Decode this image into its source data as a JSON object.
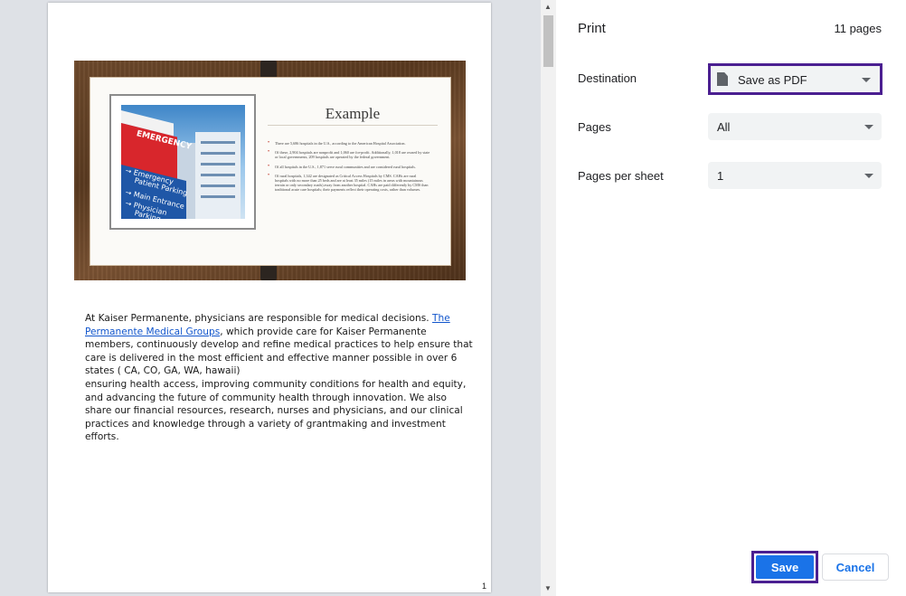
{
  "preview": {
    "slide": {
      "title": "Example",
      "photo_sign_text": [
        "EMERGENCY",
        "→ Emergency",
        "Patient Parking",
        "→ Main Entrance",
        "→ Physician",
        "Parking"
      ],
      "bullets": [
        "There are 5,686 hospitals in the U.S., according to the American Hospital Association.",
        "Of these, 2,904 hospitals are nonprofit and 1,060 are for-profit. Additionally, 1,018 are owned by state or local governments, 209 hospitals are operated by the federal government.",
        "Of all hospitals in the U.S., 1,871 serve rural communities and are considered rural hospitals.",
        "Of rural hospitals, 1,342 are designated as Critical Access Hospitals by CMS. CAHs are rural hospitals with no more than 25 beds and are at least 35 miles (15 miles in areas with mountainous terrain or only secondary roads) away from another hospital. CAHs are paid differently by CMS than traditional acute care hospitals; their payments reflect their operating costs, rather than volumes."
      ]
    },
    "paragraph": {
      "part1": "At Kaiser Permanente, physicians are responsible for medical decisions.",
      "link": "The Permanente Medical Groups",
      "part2": ", which provide care for Kaiser Permanente members, continuously develop and refine medical practices to help ensure that care is delivered in the most efficient and effective manner possible in over 6 states ( CA, CO, GA, WA, hawaii)",
      "part3": "ensuring health access, improving community  conditions for health and equity, and advancing the future of community health through innovation. We also share our financial resources, research, nurses and physicians, and our clinical practices and knowledge through a variety of grantmaking and investment efforts."
    },
    "page_number": "1"
  },
  "settings": {
    "title": "Print",
    "page_count": "11 pages",
    "destination": {
      "label": "Destination",
      "value": "Save as PDF",
      "icon": "pdf-file-icon"
    },
    "pages": {
      "label": "Pages",
      "value": "All"
    },
    "pages_per_sheet": {
      "label": "Pages per sheet",
      "value": "1"
    },
    "save_label": "Save",
    "cancel_label": "Cancel"
  },
  "colors": {
    "accent": "#1a73e8",
    "highlight_border": "#4b1f91",
    "preview_background": "#dee1e6",
    "select_background": "#f1f3f4"
  }
}
